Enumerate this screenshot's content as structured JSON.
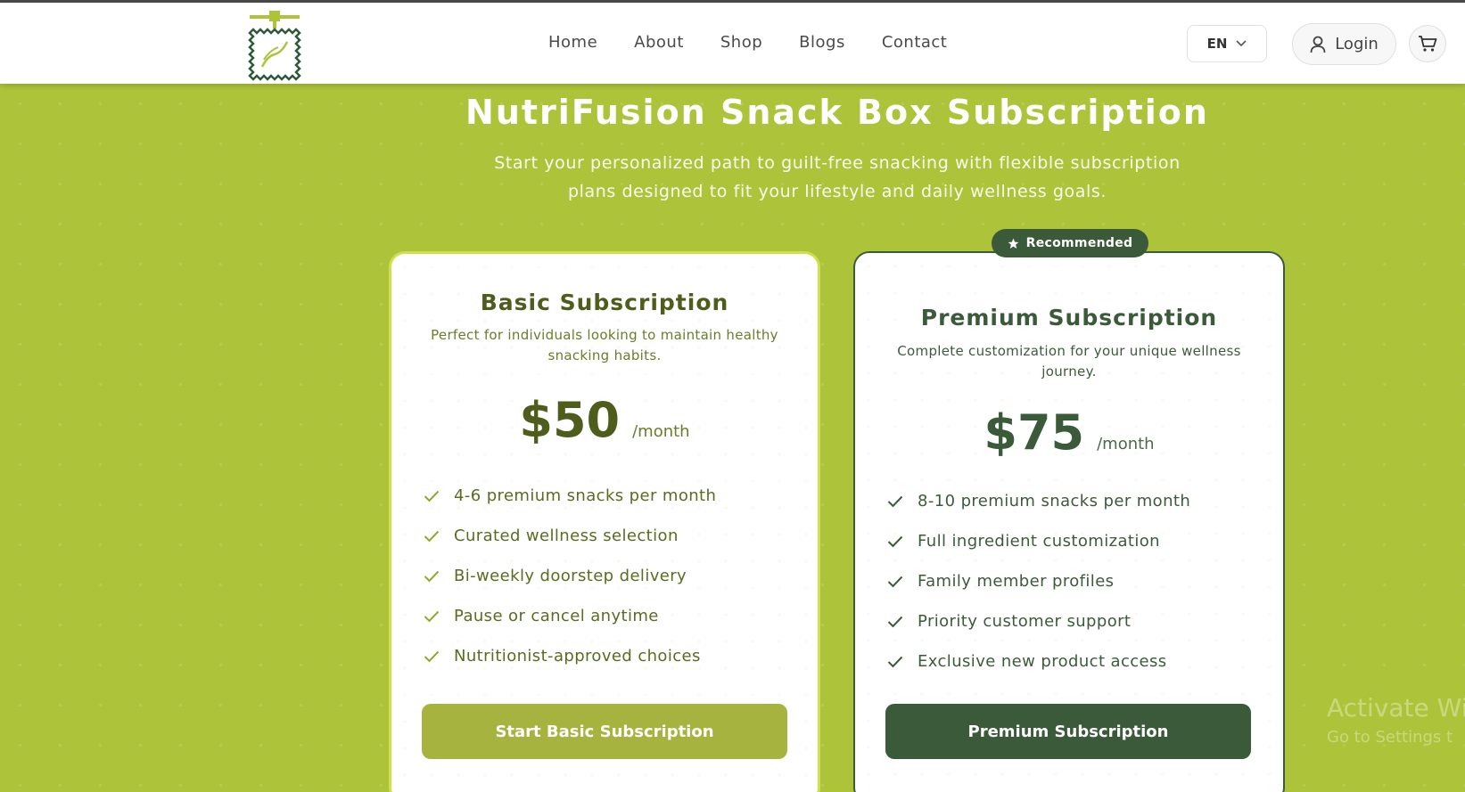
{
  "nav": {
    "items": [
      "Home",
      "About",
      "Shop",
      "Blogs",
      "Contact"
    ],
    "language": "EN",
    "login_label": "Login"
  },
  "hero": {
    "title": "NutriFusion Snack Box Subscription",
    "subtitle": "Start your personalized path to guilt-free snacking with flexible subscription plans designed to fit your lifestyle and daily wellness goals."
  },
  "plans": [
    {
      "name": "Basic Subscription",
      "description": "Perfect for individuals looking to maintain healthy snacking habits.",
      "price": "$50",
      "period": "/month",
      "features": [
        "4-6 premium snacks per month",
        "Curated wellness selection",
        "Bi-weekly doorstep delivery",
        "Pause or cancel anytime",
        "Nutritionist-approved choices"
      ],
      "cta": "Start Basic Subscription"
    },
    {
      "badge": "Recommended",
      "name": "Premium Subscription",
      "description": "Complete customization for your unique wellness journey.",
      "price": "$75",
      "period": "/month",
      "features": [
        "8-10 premium snacks per month",
        "Full ingredient customization",
        "Family member profiles",
        "Priority customer support",
        "Exclusive new product access"
      ],
      "cta": "Premium Subscription"
    }
  ],
  "watermark": {
    "line1": "Activate Wi",
    "line2": "Go to Settings t"
  },
  "colors": {
    "background": "#adc43a",
    "brand_green": "#3a5a3a",
    "basic_button": "#a6b33e",
    "basic_border": "#cfe04e"
  },
  "icons": {
    "logo": "snack-bag-logo",
    "language": "chevron-down-icon",
    "login": "user-icon",
    "cart": "cart-icon",
    "badge": "star-icon",
    "feature": "check-icon"
  }
}
